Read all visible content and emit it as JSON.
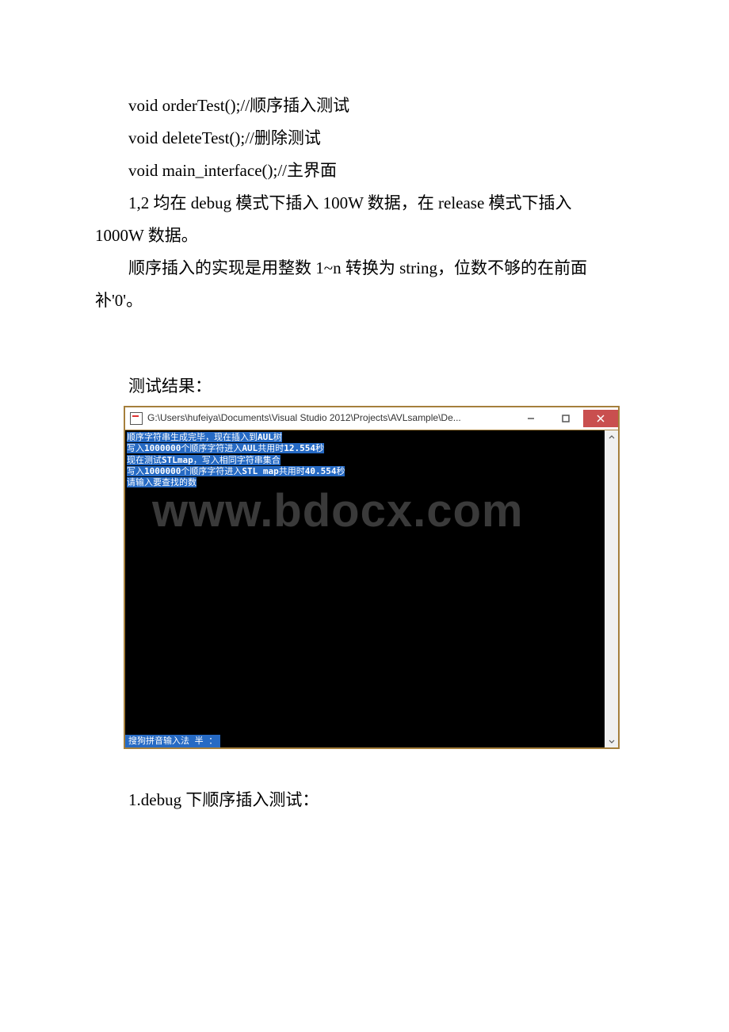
{
  "body": {
    "line1": "void orderTest();//顺序插入测试",
    "line2": "void deleteTest();//删除测试",
    "line3": " void main_interface();//主界面",
    "line4_a": " 1,2 均在 debug 模式下插入 100W 数据，在 release 模式下插入",
    "line4_b": "1000W 数据。",
    "line5_a": " 顺序插入的实现是用整数 1~n 转换为 string，位数不够的在前面",
    "line5_b": "补'0'。",
    "line6": " 测试结果：",
    "line7": "1.debug 下顺序插入测试："
  },
  "console": {
    "title": "G:\\Users\\hufeiya\\Documents\\Visual Studio 2012\\Projects\\AVLsample\\De...",
    "watermark": "www.bdocx.com",
    "ime": "搜狗拼音输入法  半 ：",
    "lines": {
      "l1_pre": "顺序字符串生成完毕，现在插入到",
      "l1_bold": "AUL",
      "l1_post": "树",
      "l2_a": "写入",
      "l2_num": "1000000",
      "l2_b": "个顺序字符进入",
      "l2_c": "AUL",
      "l2_d": "共用时",
      "l2_e": "12.554",
      "l2_f": "秒",
      "l3_a": "现在测试",
      "l3_b": "STLmap",
      "l3_c": "，写入相同字符串集合",
      "l4_a": "写入",
      "l4_num": "1000000",
      "l4_b": "个顺序字符进入",
      "l4_c": "STL map",
      "l4_d": "共用时",
      "l4_e": "40.554",
      "l4_f": "秒",
      "l5": "请输入要查找的数"
    }
  }
}
